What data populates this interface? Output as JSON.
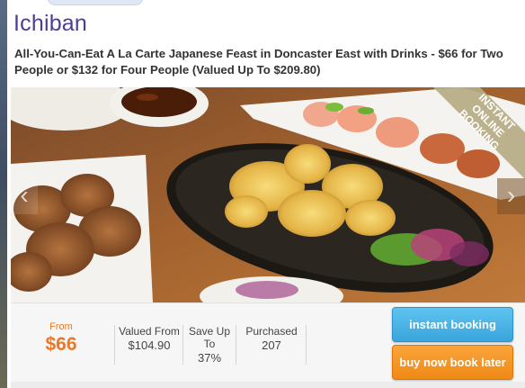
{
  "deal": {
    "title": "Ichiban",
    "subtitle": "All-You-Can-Eat A La Carte Japanese Feast in Doncaster East with Drinks - $66 for Two People or $132 for Four People (Valued Up To $209.80)"
  },
  "hero": {
    "ribbon": [
      "INSTANT",
      "ONLINE",
      "BOOKING"
    ],
    "prev_icon": "chevron-left-icon",
    "next_icon": "chevron-right-icon"
  },
  "pricing": {
    "from_label": "From",
    "price": "$66",
    "valued_label": "Valued From",
    "valued_value": "$104.90",
    "save_label_1": "Save Up",
    "save_label_2": "To",
    "save_value": "37%",
    "purchased_label": "Purchased",
    "purchased_value": "207"
  },
  "actions": {
    "instant_booking": "instant booking",
    "buy_now_book_later": "buy now book later"
  },
  "colors": {
    "title": "#4b3f95",
    "price": "#e8782a",
    "instant_button": "#3aa5dc",
    "later_button": "#ee8a16"
  }
}
